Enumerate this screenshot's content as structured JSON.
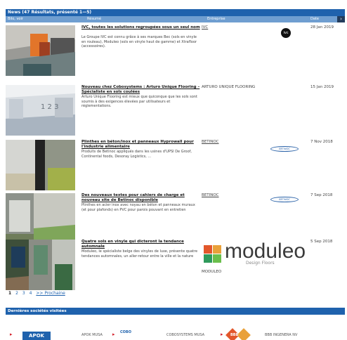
{
  "header": {
    "title": "News (47 Résultats, présenté 1—5)"
  },
  "columns": {
    "image": "Bilo, voir",
    "summary": "Résumé",
    "company": "Entreprise",
    "date": "Date"
  },
  "news": [
    {
      "title": "IVC, toutes les solutions regroupées sous un seul nom",
      "desc": "Le Groupe IVC est connu grâce à ses marques Bec (sols en vinyle en rouleau), Moduleo (sols en vinyle haut de gamme) et Xtrafloor (accessoires).",
      "company": "IVC",
      "date": "28 Jan 2019"
    },
    {
      "title": "Nouveau chez Cobosystems : Arturo Unique Flooring – Spécialiste en sols coulées",
      "desc": "Arturo Unique Flooring est mieux que quiconque que les sols sont soumis à des exigences élevées par utilisateurs et réglementations.",
      "company": "ARTURO UNIQUE FLOORING",
      "date": "15 Jan 2019"
    },
    {
      "title": "Plinthes en béton/inox et panneaux Hyprowall pour l'industrie alimentaire",
      "desc": "Produits de Betinoc appliqués dans les usines d'UPSI De Groof, Continental foods, Desoray Logistics, ...",
      "company": "BETINOC",
      "date": "7 Nov 2018"
    },
    {
      "title": "Des nouveaux textes pour cahiers de charge et nouveau site de Betinoc disponible",
      "desc": "Plinthes en acier inox avec noyau en béton et panneaux muraux (et pour plafonds) en PVC pour parois pouvant en entretien",
      "company": "BETINOC",
      "date": "7 Sep 2018"
    },
    {
      "title": "Quatre sols en vinyle qui dicteront la tendance automnale",
      "desc": "Moduleo, le spécialiste belge des vinyles de luxe, présente quatre tendances automnales, un aller-retour entre la ville et la nature",
      "company": "MODULEO",
      "date": "5 Sep 2018"
    }
  ],
  "logos": {
    "ivc": "ivc",
    "betinoc": "BETINOC",
    "moduleo": "moduleo",
    "moduleo_sub": "Design Floors"
  },
  "pager": {
    "p1": "1",
    "p2": "2",
    "p3": "3",
    "p4": "4",
    "next": ">> Prochaine"
  },
  "visited": {
    "title": "Dernières sociétés visitées",
    "items": [
      "APOK",
      "APOK MUSA",
      "COBO",
      "COBOSYSTEMS MUSA",
      "BBB",
      "BBB INGENERA NV"
    ]
  },
  "icons": [
    "arrow-right-icon",
    "chevron-right-icon"
  ]
}
